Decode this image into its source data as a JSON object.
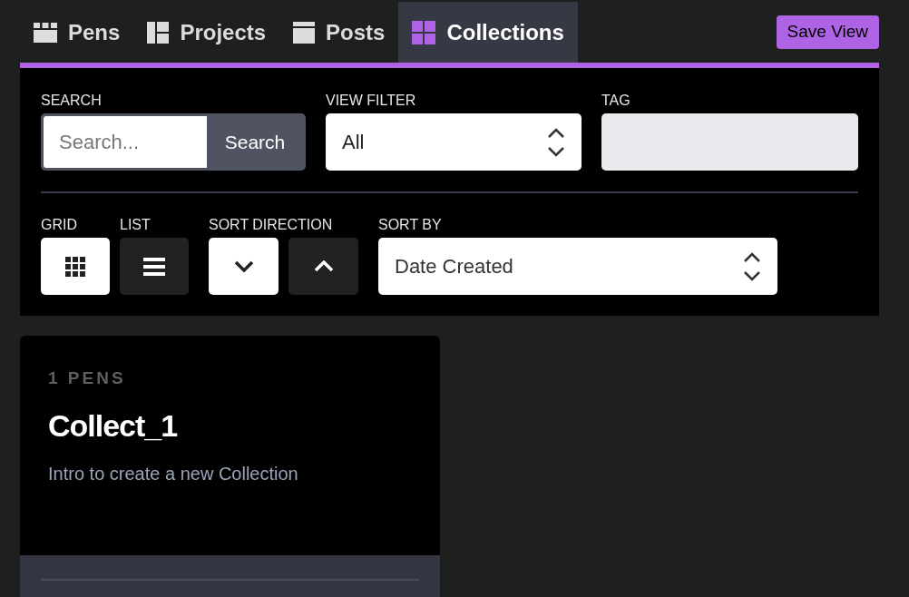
{
  "tabs": [
    {
      "label": "Pens",
      "selected": false
    },
    {
      "label": "Projects",
      "selected": false
    },
    {
      "label": "Posts",
      "selected": false
    },
    {
      "label": "Collections",
      "selected": true
    }
  ],
  "save_button": "Save View",
  "search": {
    "label": "SEARCH",
    "placeholder": "Search...",
    "button": "Search"
  },
  "view_filter": {
    "label": "VIEW FILTER",
    "value": "All"
  },
  "tag": {
    "label": "TAG"
  },
  "layout_toggles": [
    {
      "label": "GRID",
      "selected": true
    },
    {
      "label": "LIST",
      "selected": false
    }
  ],
  "sort_direction": {
    "label": "SORT DIRECTION",
    "options": [
      {
        "selected": true
      },
      {
        "selected": false
      }
    ]
  },
  "sort_by": {
    "label": "SORT BY",
    "value": "Date Created"
  },
  "collections": [
    {
      "count": "1 PENS",
      "title": "Collect_1",
      "description": "Intro to create a new Collection"
    }
  ]
}
